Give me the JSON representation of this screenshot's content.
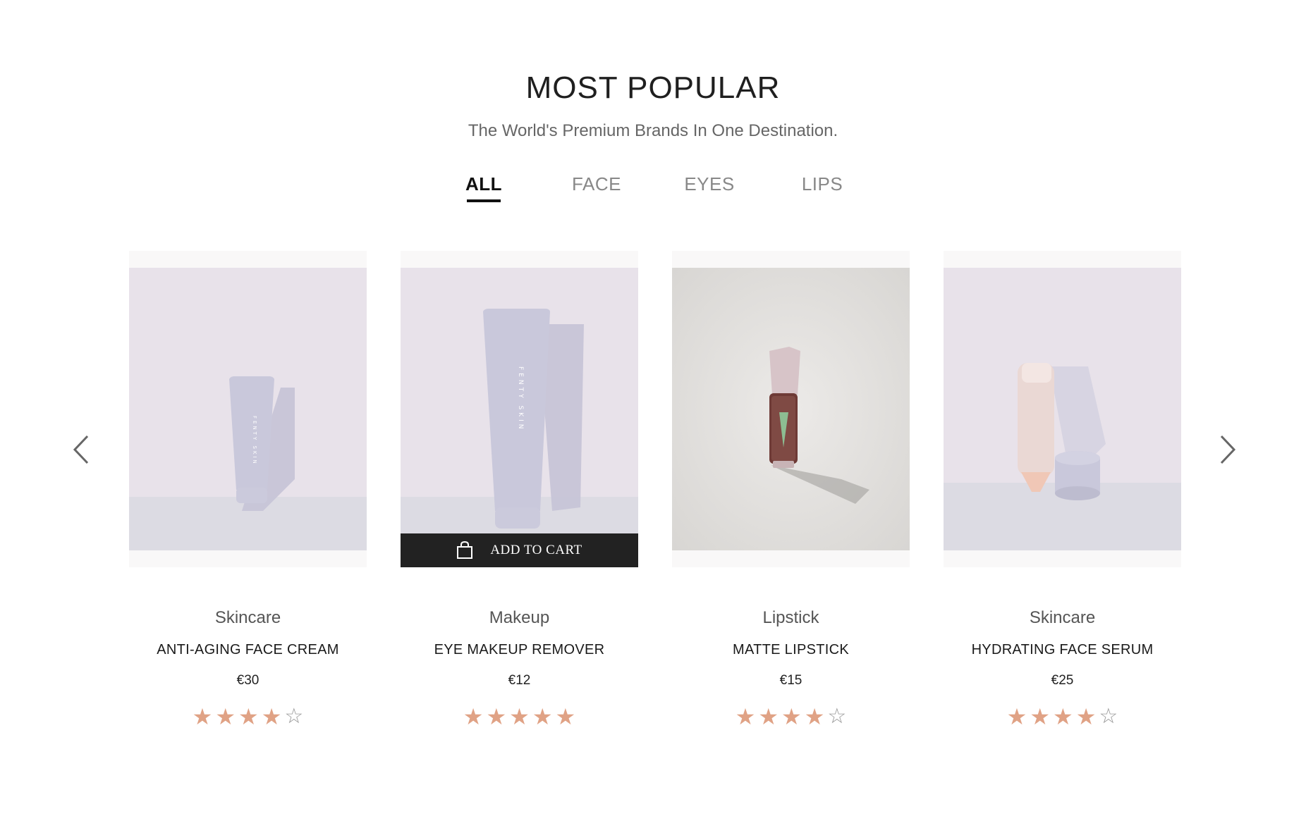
{
  "header": {
    "title": "MOST POPULAR",
    "subtitle": "The World's Premium Brands In One Destination."
  },
  "tabs": [
    {
      "label": "ALL",
      "active": true
    },
    {
      "label": "FACE",
      "active": false
    },
    {
      "label": "EYES",
      "active": false
    },
    {
      "label": "LIPS",
      "active": false
    }
  ],
  "carousel": {
    "prev_icon": "chevron-left-icon",
    "next_icon": "chevron-right-icon"
  },
  "add_to_cart_label": "ADD TO CART",
  "colors": {
    "star_filled": "#e0a285",
    "star_empty": "#9a9a9a",
    "cart_bar": "#222222",
    "tube": "#c9c8db",
    "backdrop": "#e8e2ea"
  },
  "products": [
    {
      "category": "Skincare",
      "name": "ANTI-AGING FACE CREAM",
      "price": "€30",
      "rating": 4,
      "max_rating": 5,
      "image_icon": "small-tube-icon"
    },
    {
      "category": "Makeup",
      "name": "EYE MAKEUP REMOVER",
      "price": "€12",
      "rating": 5,
      "max_rating": 5,
      "image_icon": "large-tube-icon",
      "hover_cart": true
    },
    {
      "category": "Lipstick",
      "name": "MATTE LIPSTICK",
      "price": "€15",
      "rating": 4,
      "max_rating": 5,
      "image_icon": "lip-gloss-icon"
    },
    {
      "category": "Skincare",
      "name": "HYDRATING FACE SERUM",
      "price": "€25",
      "rating": 4,
      "max_rating": 5,
      "image_icon": "serum-stick-icon"
    }
  ],
  "image_labels": {
    "tube_brand": "FENTY SKIN"
  }
}
